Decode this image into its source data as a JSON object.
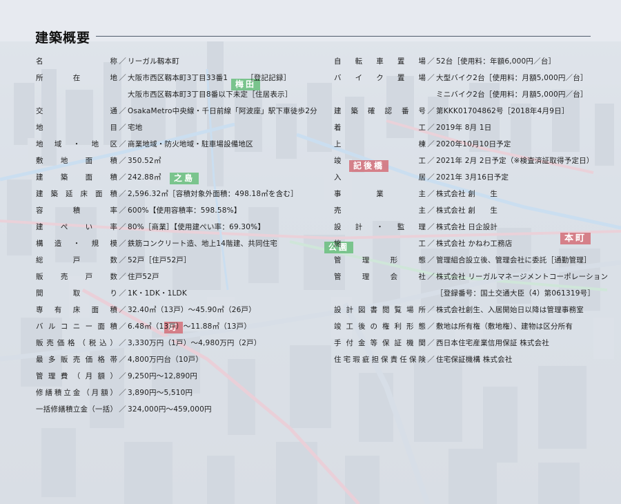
{
  "page": {
    "title": "建築概要"
  },
  "background": {
    "labels": [
      {
        "text": "梅田",
        "color": "green"
      },
      {
        "text": "之島",
        "color": "green"
      },
      {
        "text": "公園",
        "color": "green"
      },
      {
        "text": "記後橋",
        "color": "red"
      },
      {
        "text": "本町",
        "color": "red"
      },
      {
        "text": "町",
        "color": "red"
      }
    ]
  },
  "left": [
    {
      "label": "名称",
      "value": "リーガル靱本町"
    },
    {
      "label": "所在地",
      "value": "大阪市西区靱本町3丁目33番1　　　［登記記録］"
    },
    {
      "label": "",
      "value": "大阪市西区靱本町3丁目8番以下未定［住居表示］"
    },
    {
      "label": "交通",
      "value": "OsakaMetro中央線・千日前線「阿波座」駅下車徒歩2分"
    },
    {
      "label": "地目",
      "value": "宅地"
    },
    {
      "label": "地域・地区",
      "value": "商業地域・防火地域・駐車場設備地区"
    },
    {
      "label": "敷地面積",
      "value": "350.52㎡"
    },
    {
      "label": "建築面積",
      "value": "242.88㎡"
    },
    {
      "label": "建築延床面積",
      "value": "2,596.32㎡［容積対象外面積：498.18㎡を含む］"
    },
    {
      "label": "容積率",
      "value": "600%【使用容積率：598.58%】"
    },
    {
      "label": "建ぺい率",
      "value": "80%［商業］【使用建ぺい率：69.30%】"
    },
    {
      "label": "構造・規模",
      "value": "鉄筋コンクリート造、地上14階建、共同住宅"
    },
    {
      "label": "総戸数",
      "value": "52戸［住戸52戸］"
    },
    {
      "label": "販売戸数",
      "value": "住戸52戸"
    },
    {
      "label": "間取り",
      "value": "1K・1DK・1LDK"
    },
    {
      "label": "専有床面積",
      "value": "32.40㎡（13戸）～45.90㎡（26戸）"
    },
    {
      "label": "バルコニー面積",
      "value": "6.48㎡（13戸）～11.88㎡（13戸）"
    },
    {
      "label": "販売価格（税込）",
      "value": "3,330万円（1戸）～4,980万円（2戸）"
    },
    {
      "label": "最多販売価格帯",
      "value": "4,800万円台（10戸）"
    },
    {
      "label": "管理費（月額）",
      "value": "9,250円～12,890円"
    },
    {
      "label": "修繕積立金（月額）",
      "value": "3,890円～5,510円"
    },
    {
      "label": "一括修繕積立金（一括）",
      "value": "324,000円～459,000円"
    }
  ],
  "right": [
    {
      "label": "自転車置場",
      "value": "52台［使用料：年額6,000円／台］"
    },
    {
      "label": "バイク置場",
      "value": "大型バイク2台［使用料：月額5,000円／台］"
    },
    {
      "label": "",
      "value": "ミニバイク2台［使用料：月額5,000円／台］"
    },
    {
      "label": "建築確認番号",
      "value": "第KKK01704862号［2018年4月9日］"
    },
    {
      "label": "着工",
      "value": "2019年 8月 1日"
    },
    {
      "label": "上棟",
      "value": "2020年10月10日予定"
    },
    {
      "label": "竣工",
      "value": "2021年 2月 2日予定（※検査済証取得予定日）"
    },
    {
      "label": "入居",
      "value": "2021年 3月16日予定"
    },
    {
      "label": "事業主",
      "value": "株式会社 創　　生"
    },
    {
      "label": "売主",
      "value": "株式会社 創　　生"
    },
    {
      "label": "設計・監理",
      "value": "株式会社 日企設計"
    },
    {
      "label": "施工",
      "value": "株式会社 かねわ工務店"
    },
    {
      "label": "管理形態",
      "value": "管理組合設立後、管理会社に委託［通勤管理］"
    },
    {
      "label": "管理会社",
      "value": "株式会社 リーガルマネージメントコーポレーション"
    },
    {
      "label": "",
      "value": "［登録番号：国土交通大臣（4）第061319号］"
    },
    {
      "label": "設計図書閲覧場所",
      "value": "株式会社創生、入居開始日以降は管理事務室"
    },
    {
      "label": "竣工後の権利形態",
      "value": "敷地は所有権（敷地権）、建物は区分所有"
    },
    {
      "label": "手付金等保証機関",
      "value": "西日本住宅産業信用保証 株式会社"
    },
    {
      "label": "住宅瑕疵担保責任保険",
      "value": "住宅保証機構 株式会社"
    }
  ]
}
